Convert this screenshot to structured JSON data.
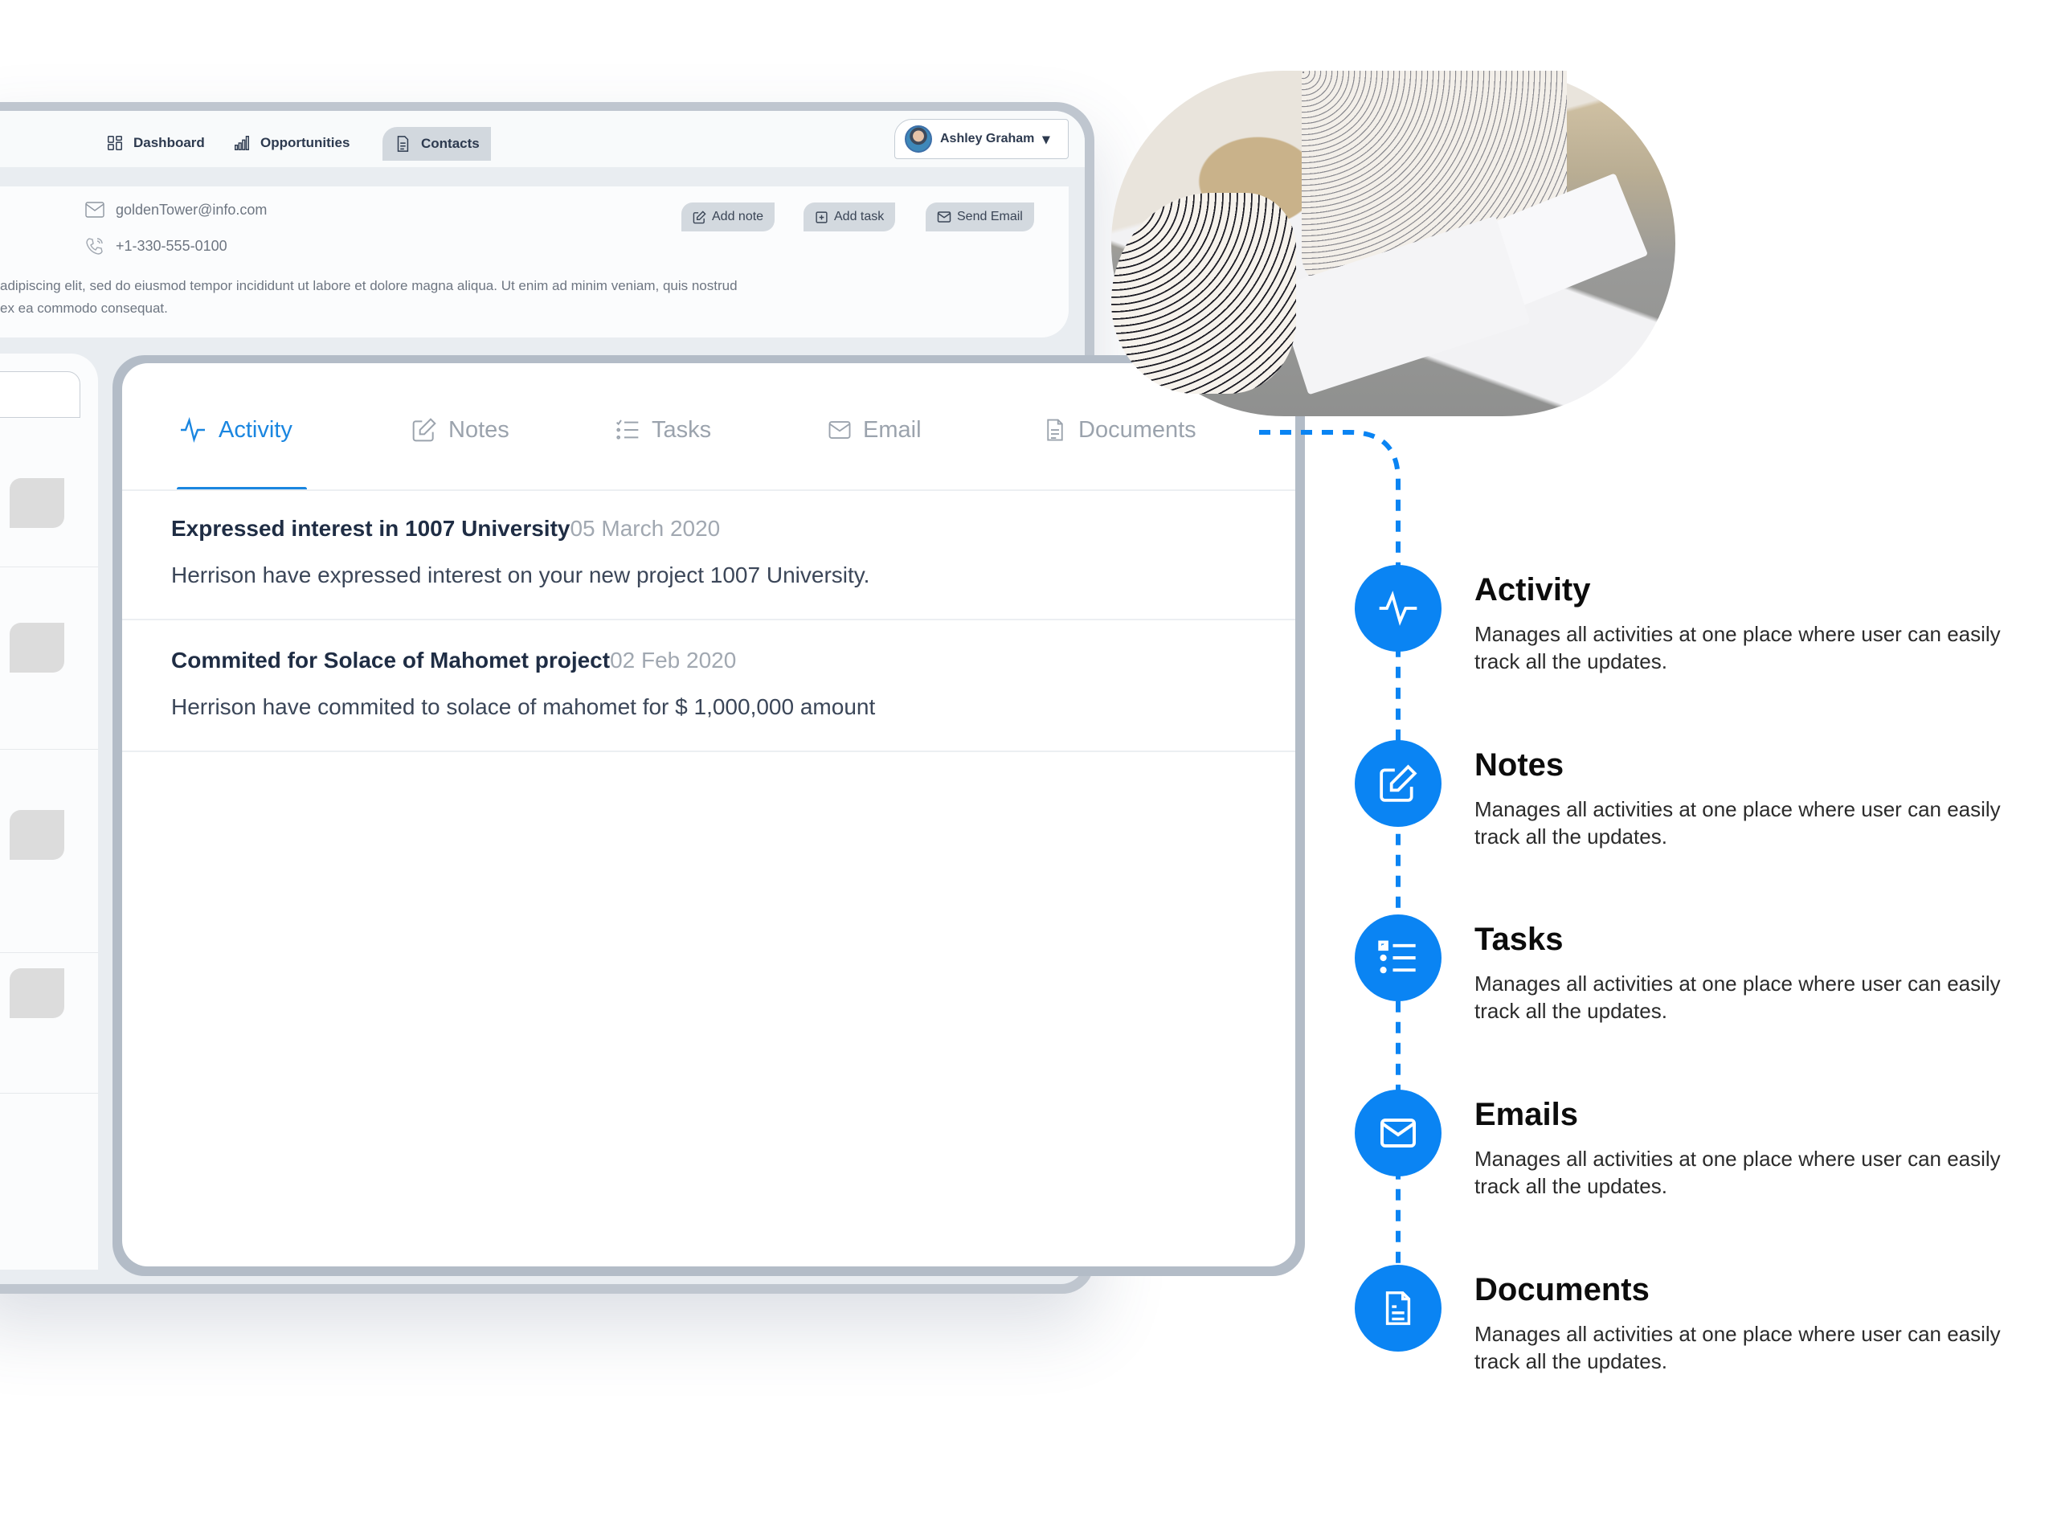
{
  "nav": {
    "items": [
      {
        "label": "Dashboard",
        "icon": "dashboard-icon",
        "active": false
      },
      {
        "label": "Opportunities",
        "icon": "bar-chart-icon",
        "active": false
      },
      {
        "label": "Contacts",
        "icon": "document-icon",
        "active": true
      }
    ],
    "user": {
      "name": "Ashley Graham",
      "caret": "▾"
    }
  },
  "contact": {
    "email": "goldenTower@info.com",
    "phone": "+1-330-555-0100",
    "description_line1": "adipiscing elit, sed do eiusmod tempor incididunt ut labore et dolore magna aliqua. Ut enim ad minim veniam, quis nostrud",
    "description_line2": "ex ea commodo consequat.",
    "actions": [
      {
        "label": "Add note",
        "icon": "edit-icon"
      },
      {
        "label": "Add task",
        "icon": "plus-square-icon"
      },
      {
        "label": "Send Email",
        "icon": "mail-icon"
      }
    ]
  },
  "tabs": [
    {
      "label": "Activity",
      "icon": "activity-icon",
      "active": true
    },
    {
      "label": "Notes",
      "icon": "edit-icon",
      "active": false
    },
    {
      "label": "Tasks",
      "icon": "task-list-icon",
      "active": false
    },
    {
      "label": "Email",
      "icon": "mail-icon",
      "active": false
    },
    {
      "label": "Documents",
      "icon": "document-icon",
      "active": false
    }
  ],
  "activities": [
    {
      "title": "Expressed interest in 1007 University",
      "date": "05 March 2020",
      "description": "Herrison have expressed interest on your new project 1007 University."
    },
    {
      "title": "Commited for Solace of Mahomet project",
      "date": "02 Feb 2020",
      "description": "Herrison have commited to solace of mahomet for $ 1,000,000 amount"
    }
  ],
  "features": [
    {
      "title": "Activity",
      "icon": "activity-icon",
      "description": "Manages all activities at one place where user can easily track all the updates."
    },
    {
      "title": "Notes",
      "icon": "edit-icon",
      "description": "Manages all activities at one place where user can easily track all the updates."
    },
    {
      "title": "Tasks",
      "icon": "task-list-icon",
      "description": "Manages all activities at one place where user can easily track all the updates."
    },
    {
      "title": "Emails",
      "icon": "mail-icon",
      "description": "Manages all activities at one place where user can easily track all the updates."
    },
    {
      "title": "Documents",
      "icon": "document-icon",
      "description": "Manages all activities at one place where user can easily track all the updates."
    }
  ],
  "colors": {
    "accent": "#0a84f3",
    "tab_active": "#1a86e0",
    "frame": "#b3bcc7",
    "button_bg": "#d3d9df"
  }
}
